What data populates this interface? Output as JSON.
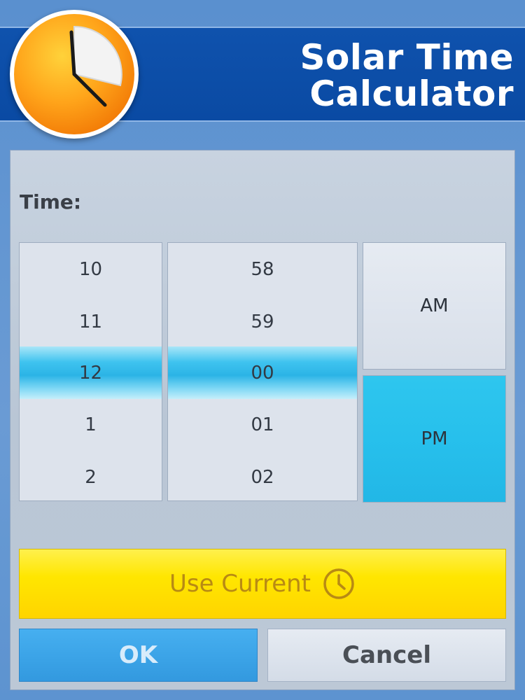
{
  "header": {
    "title_line1": "Solar Time",
    "title_line2": "Calculator",
    "logo_icon": "clock-logo-icon"
  },
  "picker": {
    "label": "Time:",
    "hours": [
      "10",
      "11",
      "12",
      "1",
      "2"
    ],
    "minutes": [
      "58",
      "59",
      "00",
      "01",
      "02"
    ],
    "selected_hour": "12",
    "selected_minute": "00",
    "am_label": "AM",
    "pm_label": "PM",
    "selected_period": "PM"
  },
  "actions": {
    "use_current_label": "Use Current",
    "use_current_icon": "clock-icon",
    "ok_label": "OK",
    "cancel_label": "Cancel"
  },
  "colors": {
    "header_bg": "#0f52ad",
    "selection": "#2bb4e6",
    "pm_active": "#27c0ec",
    "use_current_bg": "#ffe600",
    "ok_bg": "#3aa2e6"
  }
}
